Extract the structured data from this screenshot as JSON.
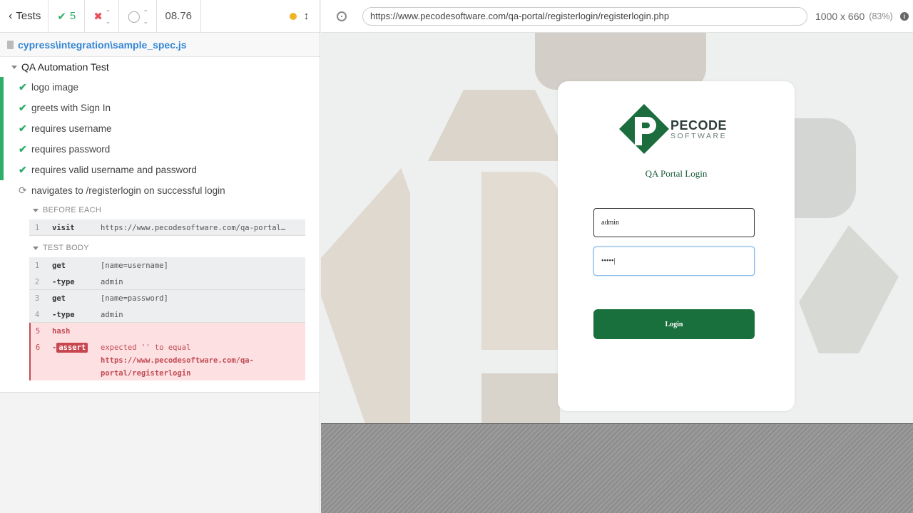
{
  "stats": {
    "tests_label": "Tests",
    "passed": "5",
    "failed": "--",
    "pending": "--",
    "duration": "08.76"
  },
  "spec": {
    "path": "cypress\\integration\\sample_spec.js"
  },
  "suite": {
    "title": "QA Automation Test",
    "tests": [
      {
        "label": "logo image",
        "state": "passed"
      },
      {
        "label": "greets with Sign In",
        "state": "passed"
      },
      {
        "label": "requires username",
        "state": "passed"
      },
      {
        "label": "requires password",
        "state": "passed"
      },
      {
        "label": "requires valid username and password",
        "state": "passed"
      },
      {
        "label": "navigates to /registerlogin on successful login",
        "state": "running"
      }
    ]
  },
  "hooks": {
    "before_each": {
      "title": "BEFORE EACH",
      "commands": [
        {
          "num": "1",
          "name": "visit",
          "message": "https://www.pecodesoftware.com/qa-portal…"
        }
      ]
    },
    "test_body": {
      "title": "TEST BODY",
      "commands": [
        {
          "num": "1",
          "name": "get",
          "message": "[name=username]"
        },
        {
          "num": "2",
          "name": "-type",
          "message": "admin"
        },
        {
          "num": "3",
          "name": "get",
          "message": "[name=password]"
        },
        {
          "num": "4",
          "name": "-type",
          "message": "admin"
        },
        {
          "num": "5",
          "name": "hash",
          "message": ""
        },
        {
          "num": "6",
          "name": "-",
          "badge": "assert",
          "message_prefix": "expected  '' to equal",
          "message_url": "https://www.pecodesoftware.com/qa-portal/registerlogin"
        }
      ]
    }
  },
  "aut": {
    "url": "https://www.pecodesoftware.com/qa-portal/registerlogin/registerlogin.php",
    "viewport": "1000 x 660",
    "scale": "(83%)"
  },
  "login": {
    "logo_line1": "PECODE",
    "logo_line2": "SOFTWARE",
    "title": "QA Portal Login",
    "username_value": "admin",
    "password_value": "•••••|",
    "button_label": "Login"
  },
  "colors": {
    "pass": "#2fae6a",
    "fail": "#e94f5d",
    "brand_green": "#19703c"
  }
}
